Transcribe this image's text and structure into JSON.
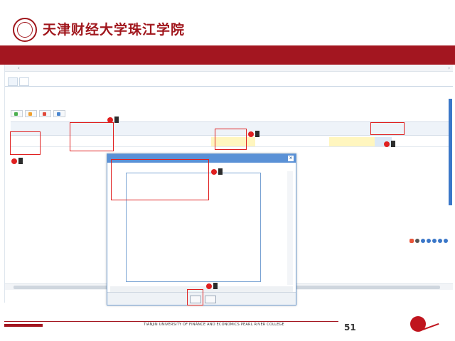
{
  "header": {
    "school_name_cn": "天津财经大学珠江学院",
    "school_name_en": ""
  },
  "screenshot": {
    "tabs": [
      "",
      ""
    ],
    "section_title": "",
    "right_note": "",
    "toolbar": {
      "buttons": [
        "",
        "",
        "",
        ""
      ]
    },
    "grid": {
      "headers": [
        "",
        "",
        "",
        "",
        "",
        "",
        "",
        "",
        ""
      ],
      "row": [
        "",
        "",
        "",
        "",
        "",
        "",
        ""
      ]
    },
    "page_info": ""
  },
  "dialog": {
    "title": "",
    "label": "",
    "value": "",
    "buttons": [
      "",
      ""
    ]
  },
  "annotations": [
    {
      "num": "",
      "text": ""
    },
    {
      "num": "",
      "text": ""
    },
    {
      "num": "",
      "text": ""
    },
    {
      "num": "",
      "text": ""
    },
    {
      "num": "",
      "text": ""
    },
    {
      "num": "",
      "text": ""
    }
  ],
  "footer": {
    "cn": "",
    "en": "TIANJIN UNIVERSITY OF FINANCE AND ECONOMICS PEARL RIVER COLLEGE",
    "page_number": "51"
  },
  "colors": {
    "brand_red": "#a31620",
    "annotation_red": "#e02020",
    "dialog_blue": "#5a91d6"
  }
}
